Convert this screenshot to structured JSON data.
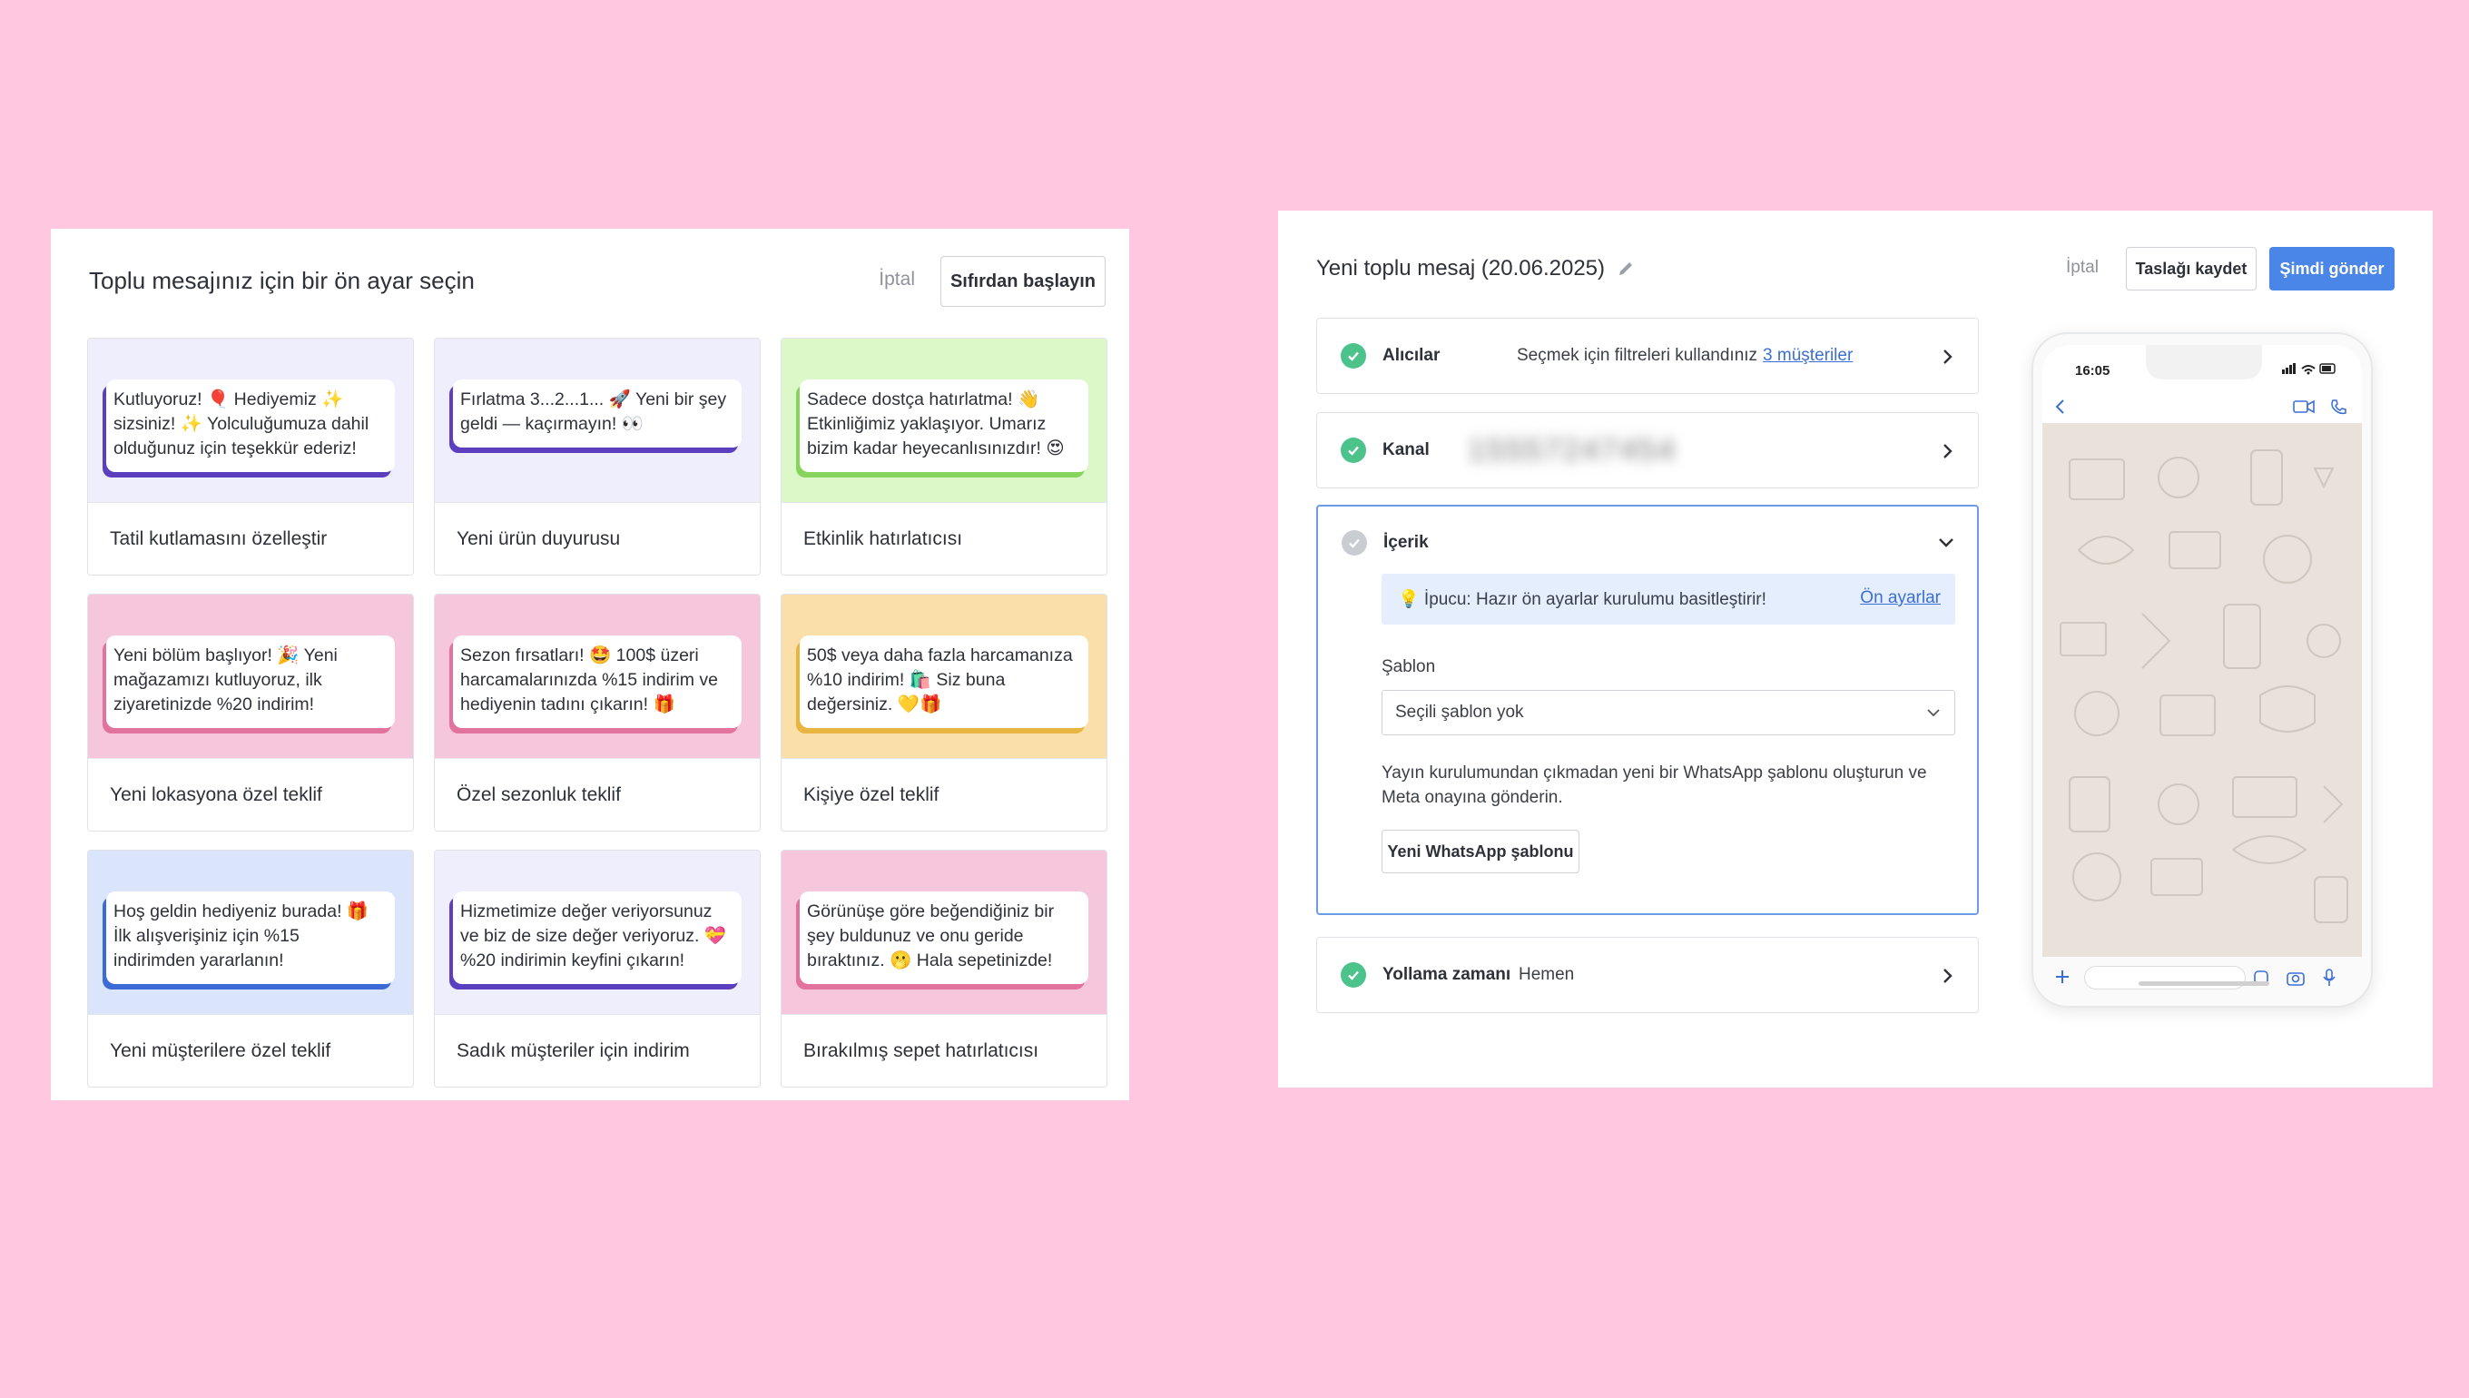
{
  "left_panel": {
    "title": "Toplu mesajınız için bir ön ayar seçin",
    "cancel_label": "İptal",
    "scratch_button": "Sıfırdan başlayın"
  },
  "presets": [
    {
      "message": "Kutluyoruz! 🎈 Hediyemiz ✨ sizsiniz! ✨ Yolculuğumuza dahil olduğunuz için teşekkür ederiz!",
      "label": "Tatil kutlamasını özelleştir",
      "bg": "#efeefc",
      "accent": "#5b3fbf"
    },
    {
      "message": "Fırlatma 3...2...1... 🚀 Yeni bir şey geldi — kaçırmayın! 👀",
      "label": "Yeni ürün duyurusu",
      "bg": "#efeefc",
      "accent": "#5b3fbf"
    },
    {
      "message": "Sadece dostça hatırlatma! 👋 Etkinliğimiz yaklaşıyor. Umarız bizim kadar heyecanlısınızdır! 😍",
      "label": "Etkinlik hatırlatıcısı",
      "bg": "#dcf7c8",
      "accent": "#86d45c"
    },
    {
      "message": "Yeni bölüm başlıyor! 🎉 Yeni mağazamızı kutluyoruz, ilk ziyaretinizde %20 indirim!",
      "label": "Yeni lokasyona özel teklif",
      "bg": "#f5c6dc",
      "accent": "#e2729e"
    },
    {
      "message": "Sezon fırsatları! 🤩 100$ üzeri harcamalarınızda %15 indirim ve hediyenin tadını çıkarın! 🎁",
      "label": "Özel sezonluk teklif",
      "bg": "#f5c6dc",
      "accent": "#e2729e"
    },
    {
      "message": "50$ veya daha fazla harcamanıza %10 indirim! 🛍️ Siz buna değersiniz. 💛🎁",
      "label": "Kişiye özel teklif",
      "bg": "#fae0a8",
      "accent": "#e8b640"
    },
    {
      "message": "Hoş geldin hediyeniz burada! 🎁 İlk alışverişiniz için %15 indirimden yararlanın!",
      "label": "Yeni müşterilere özel teklif",
      "bg": "#dae5fb",
      "accent": "#3d6bd6"
    },
    {
      "message": "Hizmetimize değer veriyorsunuz ve biz de size değer veriyoruz. 💝 %20 indirimin keyfini çıkarın!",
      "label": "Sadık müşteriler için indirim",
      "bg": "#efeefc",
      "accent": "#5b3fbf"
    },
    {
      "message": "Görünüşe göre beğendiğiniz bir şey buldunuz ve onu geride bıraktınız. 🫢 Hala sepetinizde!",
      "label": "Bırakılmış sepet hatırlatıcısı",
      "bg": "#f5c6dc",
      "accent": "#e2729e"
    }
  ],
  "right_panel": {
    "title": "Yeni toplu mesaj (20.06.2025)",
    "cancel_label": "İptal",
    "draft_button": "Taslağı kaydet",
    "send_button": "Şimdi gönder",
    "recipients": {
      "name": "Alıcılar",
      "text": "Seçmek için filtreleri kullandınız",
      "link": "3 müşteriler"
    },
    "channel": {
      "name": "Kanal",
      "value": "15557247454"
    },
    "content": {
      "name": "İçerik",
      "tip_text": "💡 İpucu: Hazır ön ayarlar kurulumu basitleştirir!",
      "tip_link": "Ön ayarlar",
      "template_label": "Şablon",
      "template_value": "Seçili şablon yok",
      "help_text": "Yayın kurulumundan çıkmadan yeni bir WhatsApp şablonu oluşturun ve Meta onayına gönderin.",
      "new_template_button": "Yeni WhatsApp şablonu"
    },
    "schedule": {
      "name": "Yollama zamanı",
      "value": "Hemen"
    }
  },
  "phone": {
    "time": "16:05"
  },
  "colors": {
    "page_bg": "#ffc8e0",
    "primary": "#4a86e8",
    "success": "#4cc38a",
    "link": "#3b6fd6"
  }
}
